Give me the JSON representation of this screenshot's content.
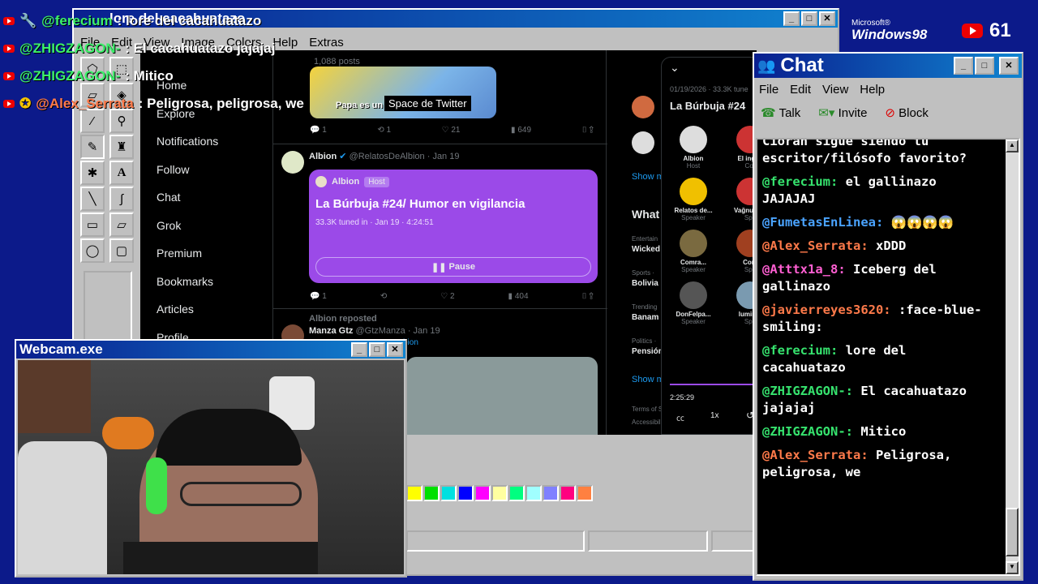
{
  "overlay": {
    "messages": [
      {
        "user": "@ferecium",
        "text": ": lore del cacahuatazo",
        "badge": "wrench",
        "user_color": "#3cf06a"
      },
      {
        "user": "@ZHIGZAGON-",
        "text": ": El cacahuatazo jajajaj",
        "badge": "",
        "user_color": "#3cf06a"
      },
      {
        "user": "@ZHIGZAGON-",
        "text": ": Mitico",
        "badge": "",
        "user_color": "#3cf06a"
      },
      {
        "user": "@Alex_Serrata",
        "text": ": Peligrosa, peligrosa, we",
        "badge": "coin",
        "user_color": "#ff7a4a"
      }
    ],
    "win98_logo_top": "Microsoft®",
    "win98_logo": "Windows98",
    "viewers": "61"
  },
  "paint": {
    "title": "lore del cacahuatazo",
    "menu": [
      "File",
      "Edit",
      "View",
      "Image",
      "Colors",
      "Help",
      "Extras"
    ],
    "palette": [
      "#ffff00",
      "#00e000",
      "#00e0e0",
      "#0000ff",
      "#ff00ff",
      "#ffffa0",
      "#00ff80",
      "#a0ffff",
      "#8080ff",
      "#ff0080",
      "#ff8040"
    ]
  },
  "twitter": {
    "nav": [
      "Home",
      "Explore",
      "Notifications",
      "Follow",
      "Chat",
      "Grok",
      "Premium",
      "Bookmarks",
      "Articles",
      "Profile"
    ],
    "top_post": {
      "posts": "1,088 posts",
      "image_caption": "Papa es un",
      "tooltip": "Space de Twitter",
      "reply": "1",
      "repost": "1",
      "like": "21",
      "views": "649"
    },
    "post": {
      "name": "Albion",
      "handle": "@RelatosDeAlbion · Jan 19",
      "host_name": "Albion",
      "host_tag": "Host",
      "space_title": "La Búrbuja #24/ Humor en vigilancia",
      "tuned": "33.3K tuned in · Jan 19 · 4:24:51",
      "pause": "Pause",
      "reply": "1",
      "like": "2",
      "views": "404"
    },
    "repost": {
      "label": "Albion reposted",
      "name": "Manza Gtz",
      "handle": "@GtzManza · Jan 19",
      "text": "bion"
    },
    "space_panel": {
      "date": "01/19/2026 · 33.3K tune",
      "title": "La Búrbuja #24",
      "time": "2:25:29",
      "speed": "1x",
      "speakers": [
        {
          "name": "Albion",
          "role": "Host"
        },
        {
          "name": "El ingen",
          "role": "Co-"
        },
        {
          "name": "Relatos de...",
          "role": "Speaker"
        },
        {
          "name": "Vağnune...",
          "role": "Spe"
        },
        {
          "name": "Comra...",
          "role": "Speaker"
        },
        {
          "name": "Com",
          "role": "Spe"
        },
        {
          "name": "DonFelpa...",
          "role": "Speaker"
        },
        {
          "name": "luminat",
          "role": "Spe"
        }
      ]
    },
    "right_col": {
      "show_more": "Show m",
      "whats": "What",
      "trends": [
        {
          "cat": "Entertain",
          "name": "Wicked"
        },
        {
          "cat": "Sports ·",
          "name": "Bolivia"
        },
        {
          "cat": "Trending",
          "name": "Banam"
        },
        {
          "cat": "Politics ·",
          "name": "Pensión"
        }
      ],
      "show_more2": "Show m",
      "terms": "Terms of S",
      "access": "Accessibil"
    }
  },
  "chat_window": {
    "title": "Chat",
    "menu": [
      "File",
      "Edit",
      "View",
      "Help"
    ],
    "toolbar": {
      "talk": "Talk",
      "invite": "Invite",
      "block": "Block"
    },
    "messages": [
      {
        "user": "",
        "text": "Cioran sigue siendo tu escritor/filósofo favorito?",
        "cls": ""
      },
      {
        "user": "@ferecium:",
        "text": "el gallinazo JAJAJAJ",
        "cls": "cn"
      },
      {
        "user": "@FumetasEnLinea:",
        "text": "😱😱😱😱",
        "cls": "cb"
      },
      {
        "user": "@Alex_Serrata:",
        "text": "xDDD",
        "cls": "co"
      },
      {
        "user": "@Atttx1a_8:",
        "text": "Iceberg del gallinazo",
        "cls": "cp"
      },
      {
        "user": "@javierreyes3620:",
        "text": ":face-blue-smiling:",
        "cls": "co"
      },
      {
        "user": "@ferecium:",
        "text": "lore del cacahuatazo",
        "cls": "cn"
      },
      {
        "user": "@ZHIGZAGON-:",
        "text": "El cacahuatazo jajajaj",
        "cls": "cn"
      },
      {
        "user": "@ZHIGZAGON-:",
        "text": "Mitico",
        "cls": "cn"
      },
      {
        "user": "@Alex_Serrata:",
        "text": "Peligrosa, peligrosa, we",
        "cls": "co"
      }
    ]
  },
  "webcam": {
    "title": "Webcam.exe"
  }
}
